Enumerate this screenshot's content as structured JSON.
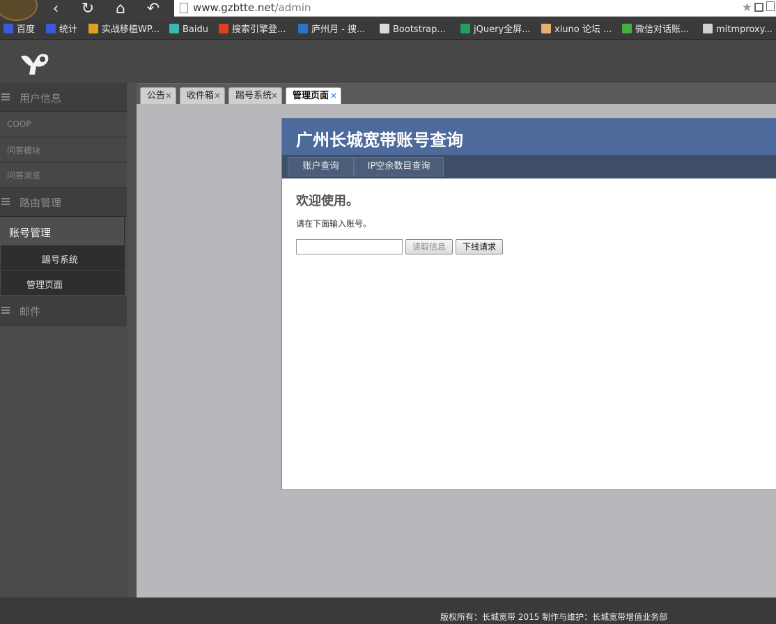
{
  "browser": {
    "url_host": "www.gzbtte.net",
    "url_path": "/admin",
    "bookmarks": [
      {
        "label": "百度",
        "color": "#3a5ad8"
      },
      {
        "label": "统计",
        "color": "#3a5ad8"
      },
      {
        "label": "实战移植WP...",
        "color": "#e0a020"
      },
      {
        "label": "Baidu",
        "color": "#38b8b0"
      },
      {
        "label": "搜索引擎登...",
        "color": "#e04020"
      },
      {
        "label": "庐州月 - 搜...",
        "color": "#2a74c8"
      },
      {
        "label": "Bootstrap...",
        "color": "#d8d8d8"
      },
      {
        "label": "jQuery全屏...",
        "color": "#20a060"
      },
      {
        "label": "xiuno 论坛 ...",
        "color": "#e8b070"
      },
      {
        "label": "微信对话账...",
        "color": "#40b040"
      },
      {
        "label": "mitmproxy...",
        "color": "#d0d0d0"
      }
    ]
  },
  "sidebar": {
    "group_user": "用户信息",
    "item_coop": "COOP",
    "item_qa_module": "问答模块",
    "item_qa_browse": "问答浏览",
    "group_router": "路由管理",
    "group_account": "账号管理",
    "child_kick": "踢号系统",
    "child_manage": "管理页面",
    "group_mail": "邮件"
  },
  "tabs": [
    {
      "label": "公告",
      "close": "×"
    },
    {
      "label": "收件箱",
      "close": "×"
    },
    {
      "label": "踢号系统",
      "close": "×"
    },
    {
      "label": "管理页面",
      "close": "×"
    }
  ],
  "panel": {
    "title": "广州长城宽带账号查询",
    "nav": [
      "账户查询",
      "IP空余数目查询"
    ],
    "welcome": "欢迎使用。",
    "prompt": "请在下面输入账号。",
    "input_value": "",
    "read_button": "读取信息",
    "offline_button": "下线请求"
  },
  "footer": {
    "text": "版权所有：长城宽带 2015 制作与维护：长城宽带增值业务部"
  },
  "colors": {
    "panel_header": "#4d6a9d",
    "panel_nav": "#3f4f68",
    "content_bg": "#b7b7bc"
  }
}
